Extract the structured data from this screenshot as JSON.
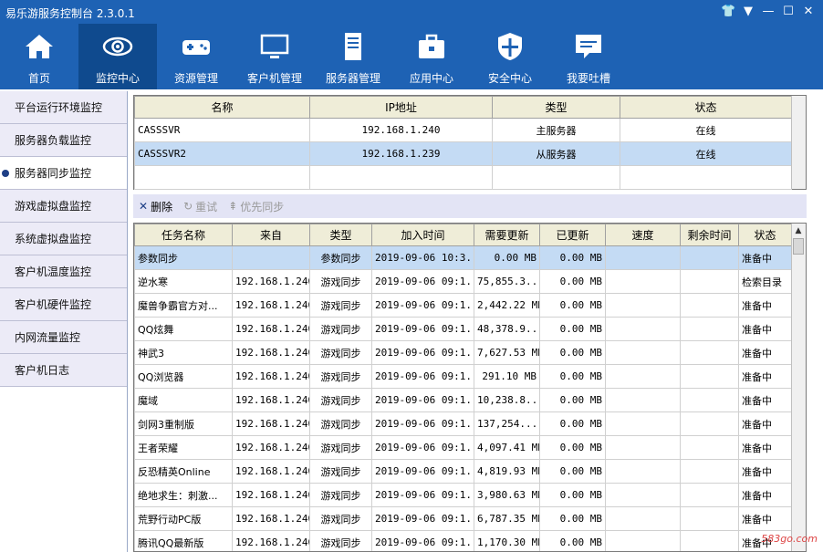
{
  "app": {
    "title": "易乐游服务控制台 2.3.0.1"
  },
  "nav": [
    {
      "label": "首页",
      "icon": "home-icon"
    },
    {
      "label": "监控中心",
      "icon": "eye-icon",
      "active": true
    },
    {
      "label": "资源管理",
      "icon": "gamepad-icon"
    },
    {
      "label": "客户机管理",
      "icon": "monitor-icon"
    },
    {
      "label": "服务器管理",
      "icon": "server-icon"
    },
    {
      "label": "应用中心",
      "icon": "toolbox-icon"
    },
    {
      "label": "安全中心",
      "icon": "shield-icon"
    },
    {
      "label": "我要吐槽",
      "icon": "chat-icon"
    }
  ],
  "sidebar": [
    "平台运行环境监控",
    "服务器负载监控",
    "服务器同步监控",
    "游戏虚拟盘监控",
    "系统虚拟盘监控",
    "客户机温度监控",
    "客户机硬件监控",
    "内网流量监控",
    "客户机日志"
  ],
  "servers": {
    "headers": [
      "名称",
      "IP地址",
      "类型",
      "状态"
    ],
    "rows": [
      [
        "CASSSVR",
        "192.168.1.240",
        "主服务器",
        "在线"
      ],
      [
        "CASSSVR2",
        "192.168.1.239",
        "从服务器",
        "在线"
      ]
    ]
  },
  "toolbar": {
    "delete": "删除",
    "retry": "重试",
    "priority": "优先同步"
  },
  "tasks": {
    "headers": [
      "任务名称",
      "来自",
      "类型",
      "加入时间",
      "需要更新",
      "已更新",
      "速度",
      "剩余时间",
      "状态"
    ],
    "rows": [
      [
        "参数同步",
        "",
        "参数同步",
        "2019-09-06 10:3...",
        "0.00 MB",
        "0.00 MB",
        "",
        "",
        "准备中"
      ],
      [
        "逆水寒",
        "192.168.1.240",
        "游戏同步",
        "2019-09-06 09:1...",
        "75,855.3...",
        "0.00 MB",
        "",
        "",
        "检索目录"
      ],
      [
        "魔兽争霸官方对...",
        "192.168.1.240",
        "游戏同步",
        "2019-09-06 09:1...",
        "2,442.22 MB",
        "0.00 MB",
        "",
        "",
        "准备中"
      ],
      [
        "QQ炫舞",
        "192.168.1.240",
        "游戏同步",
        "2019-09-06 09:1...",
        "48,378.9...",
        "0.00 MB",
        "",
        "",
        "准备中"
      ],
      [
        "神武3",
        "192.168.1.240",
        "游戏同步",
        "2019-09-06 09:1...",
        "7,627.53 MB",
        "0.00 MB",
        "",
        "",
        "准备中"
      ],
      [
        "QQ浏览器",
        "192.168.1.240",
        "游戏同步",
        "2019-09-06 09:1...",
        "291.10 MB",
        "0.00 MB",
        "",
        "",
        "准备中"
      ],
      [
        "魔域",
        "192.168.1.240",
        "游戏同步",
        "2019-09-06 09:1...",
        "10,238.8...",
        "0.00 MB",
        "",
        "",
        "准备中"
      ],
      [
        "剑网3重制版",
        "192.168.1.240",
        "游戏同步",
        "2019-09-06 09:1...",
        "137,254....",
        "0.00 MB",
        "",
        "",
        "准备中"
      ],
      [
        "王者荣耀",
        "192.168.1.240",
        "游戏同步",
        "2019-09-06 09:1...",
        "4,097.41 MB",
        "0.00 MB",
        "",
        "",
        "准备中"
      ],
      [
        "反恐精英Online",
        "192.168.1.240",
        "游戏同步",
        "2019-09-06 09:1...",
        "4,819.93 MB",
        "0.00 MB",
        "",
        "",
        "准备中"
      ],
      [
        "绝地求生：刺激...",
        "192.168.1.240",
        "游戏同步",
        "2019-09-06 09:1...",
        "3,980.63 MB",
        "0.00 MB",
        "",
        "",
        "准备中"
      ],
      [
        "荒野行动PC版",
        "192.168.1.240",
        "游戏同步",
        "2019-09-06 09:1...",
        "6,787.35 MB",
        "0.00 MB",
        "",
        "",
        "准备中"
      ],
      [
        "腾讯QQ最新版",
        "192.168.1.240",
        "游戏同步",
        "2019-09-06 09:1...",
        "1,170.30 MB",
        "0.00 MB",
        "",
        "",
        "准备中"
      ]
    ]
  },
  "watermark": "583go.com",
  "colors": {
    "header": "#1e62b4",
    "nav_active": "#0f4a8e",
    "selected_row": "#c4dbf4",
    "table_header": "#efedd8"
  }
}
